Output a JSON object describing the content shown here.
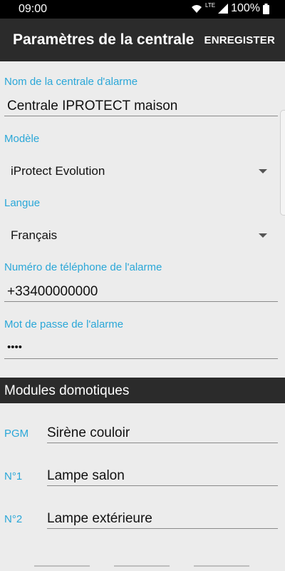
{
  "status_bar": {
    "time": "09:00",
    "network": "LTE",
    "battery": "100%",
    "icons": [
      "wifi-icon",
      "signal-icon",
      "battery-icon"
    ]
  },
  "app_bar": {
    "title": "Paramètres de la centrale",
    "save_label": "ENREGISTER"
  },
  "form": {
    "name": {
      "label": "Nom de la centrale d'alarme",
      "value": "Centrale IPROTECT maison"
    },
    "model": {
      "label": "Modèle",
      "value": "iProtect Evolution"
    },
    "language": {
      "label": "Langue",
      "value": "Français"
    },
    "phone": {
      "label": "Numéro de téléphone de l'alarme",
      "value": "+33400000000"
    },
    "password": {
      "label": "Mot de passe de l'alarme",
      "value": "••••"
    }
  },
  "modules": {
    "title": "Modules domotiques",
    "items": [
      {
        "label": "PGM",
        "value": "Sirène couloir"
      },
      {
        "label": "N°1",
        "value": "Lampe salon"
      },
      {
        "label": "N°2",
        "value": "Lampe extérieure"
      }
    ]
  },
  "colors": {
    "accent": "#2aa7d8",
    "app_bar": "#2b2b2b",
    "background": "#ececec"
  }
}
